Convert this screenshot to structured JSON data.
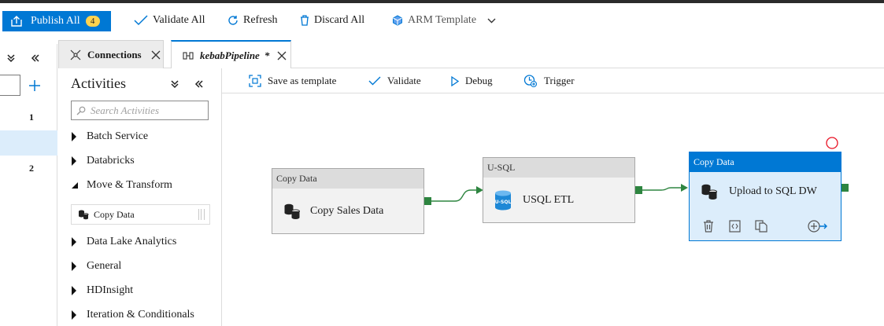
{
  "toolbar": {
    "publish_label": "Publish All",
    "publish_count": "4",
    "validate_label": "Validate All",
    "refresh_label": "Refresh",
    "discard_label": "Discard All",
    "arm_label": "ARM Template"
  },
  "left_strip": {
    "row1": "1",
    "row2": "2"
  },
  "tabs": [
    {
      "label": "Connections"
    },
    {
      "label": "kebabPipeline",
      "dirty": "*"
    }
  ],
  "activities": {
    "title": "Activities",
    "search_placeholder": "Search Activities",
    "categories": [
      {
        "label": "Batch Service",
        "expanded": false
      },
      {
        "label": "Databricks",
        "expanded": false
      },
      {
        "label": "Move & Transform",
        "expanded": true
      },
      {
        "label": "Data Lake Analytics",
        "expanded": false
      },
      {
        "label": "General",
        "expanded": false
      },
      {
        "label": "HDInsight",
        "expanded": false
      },
      {
        "label": "Iteration & Conditionals",
        "expanded": false
      }
    ],
    "move_items": [
      {
        "label": "Copy Data",
        "icon": "copy-data-icon"
      }
    ]
  },
  "pipeline_toolbar": {
    "save_template": "Save as template",
    "validate": "Validate",
    "debug": "Debug",
    "trigger": "Trigger"
  },
  "canvas": {
    "nodes": [
      {
        "type": "Copy Data",
        "name": "Copy Sales Data",
        "icon": "copy-data-icon",
        "selected": false
      },
      {
        "type": "U-SQL",
        "name": "USQL ETL",
        "icon": "usql-icon",
        "selected": false
      },
      {
        "type": "Copy Data",
        "name": "Upload to SQL DW",
        "icon": "copy-data-icon",
        "selected": true
      }
    ]
  },
  "colors": {
    "accent": "#0078d4",
    "port": "#2e8540",
    "selected_fill": "#dcedfb",
    "error_marker": "#e81123",
    "badge": "#ffd34f"
  }
}
